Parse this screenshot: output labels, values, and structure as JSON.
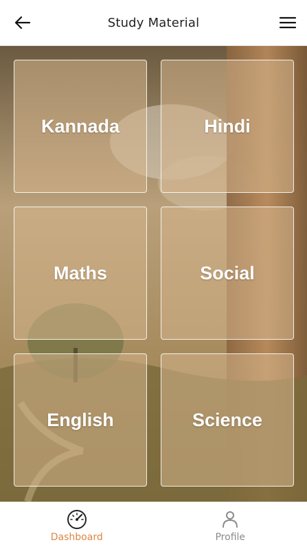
{
  "header": {
    "title": "Study Material",
    "back_icon": "arrow-left-icon",
    "menu_icon": "hamburger-menu-icon"
  },
  "subjects": [
    {
      "label": "Kannada"
    },
    {
      "label": "Hindi"
    },
    {
      "label": "Maths"
    },
    {
      "label": "Social"
    },
    {
      "label": "English"
    },
    {
      "label": "Science"
    }
  ],
  "bottom_nav": {
    "items": [
      {
        "label": "Dashboard",
        "icon": "speedometer-icon",
        "active": true
      },
      {
        "label": "Profile",
        "icon": "person-icon",
        "active": false
      }
    ]
  },
  "colors": {
    "accent": "#d98744",
    "inactive": "#8a8a8a"
  }
}
